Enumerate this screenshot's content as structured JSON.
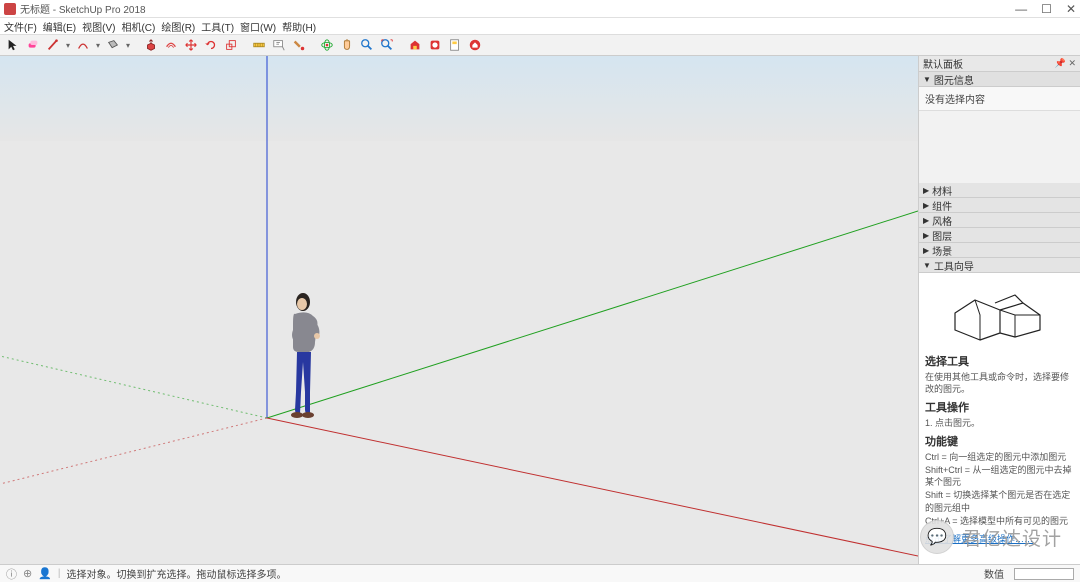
{
  "window": {
    "title": "无标题 - SketchUp Pro 2018",
    "min": "—",
    "max": "☐",
    "close": "✕"
  },
  "menu": {
    "file": "文件(F)",
    "edit": "编辑(E)",
    "view": "视图(V)",
    "camera": "相机(C)",
    "draw": "绘图(R)",
    "tools": "工具(T)",
    "window": "窗口(W)",
    "help": "帮助(H)"
  },
  "side": {
    "default_panel": "默认面板",
    "entity_info": "图元信息",
    "no_selection": "没有选择内容",
    "materials": "材料",
    "components": "组件",
    "styles": "风格",
    "layers": "图层",
    "scenes": "场景",
    "instructor": "工具向导"
  },
  "instructor": {
    "tool_title": "选择工具",
    "tool_desc": "在使用其他工具或命令时，选择要修改的图元。",
    "op_title": "工具操作",
    "op_1": "1. 点击图元。",
    "keys_title": "功能键",
    "k1": "Ctrl = 向一组选定的图元中添加图元",
    "k2": "Shift+Ctrl = 从一组选定的图元中去掉某个图元",
    "k3": "Shift = 切换选择某个图元是否在选定的图元组中",
    "k4": "Ctrl+A = 选择模型中所有可见的图元",
    "more": "点击了解更多高级操作……"
  },
  "status": {
    "msg": "选择对象。切换到扩充选择。拖动鼠标选择多项。",
    "measure_label": "数值"
  },
  "watermark": {
    "text": "君亿达设计"
  }
}
